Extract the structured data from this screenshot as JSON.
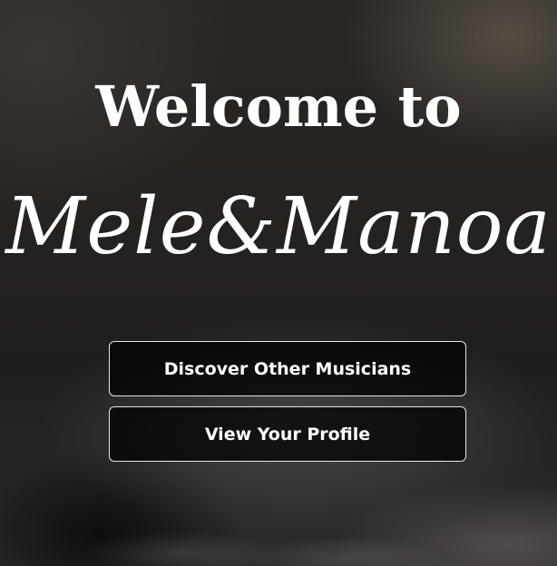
{
  "hero": {
    "welcome_text": "Welcome to",
    "logo_text": "Mele&Manoa"
  },
  "actions": {
    "discover_label": "Discover Other Musicians",
    "profile_label": "View Your Profile"
  }
}
